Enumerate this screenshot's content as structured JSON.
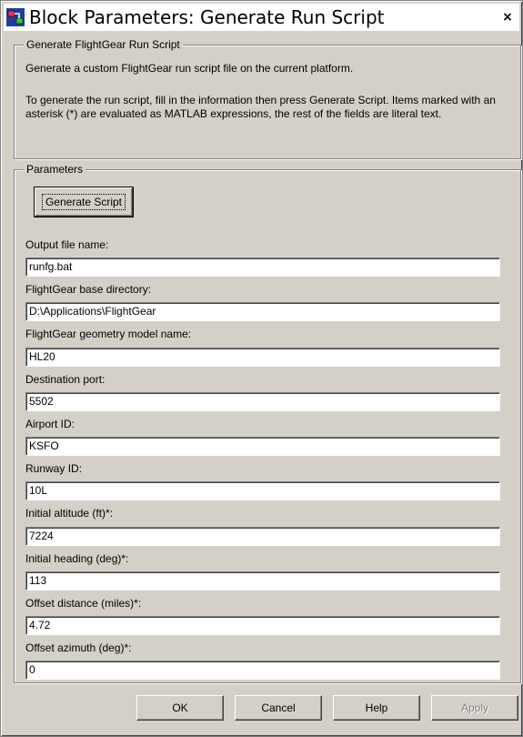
{
  "window": {
    "title": "Block Parameters: Generate Run Script",
    "close_glyph": "×",
    "icon": "simulink-block-icon"
  },
  "description_group": {
    "legend": "Generate FlightGear Run Script",
    "line1": "Generate a custom FlightGear run script file on the current platform.",
    "line2": "To generate the run script, fill in the information then press Generate Script.  Items marked with an asterisk (*) are evaluated as MATLAB expressions, the rest of the fields are literal text."
  },
  "parameters_group": {
    "legend": "Parameters",
    "generate_button": "Generate Script",
    "fields": [
      {
        "label": "Output file name:",
        "value": "runfg.bat"
      },
      {
        "label": "FlightGear base directory:",
        "value": "D:\\Applications\\FlightGear"
      },
      {
        "label": "FlightGear geometry model name:",
        "value": "HL20"
      },
      {
        "label": "Destination port:",
        "value": "5502"
      },
      {
        "label": "Airport ID:",
        "value": "KSFO"
      },
      {
        "label": "Runway ID:",
        "value": "10L"
      },
      {
        "label": "Initial altitude (ft)*:",
        "value": "7224"
      },
      {
        "label": "Initial heading (deg)*:",
        "value": "113"
      },
      {
        "label": "Offset distance (miles)*:",
        "value": "4.72"
      },
      {
        "label": "Offset azimuth (deg)*:",
        "value": "0"
      }
    ]
  },
  "footer": {
    "ok": "OK",
    "cancel": "Cancel",
    "help": "Help",
    "apply": "Apply"
  },
  "colors": {
    "dialog_face": "#d4d0c8",
    "field_bg": "#ffffff",
    "disabled_text": "#808080"
  }
}
